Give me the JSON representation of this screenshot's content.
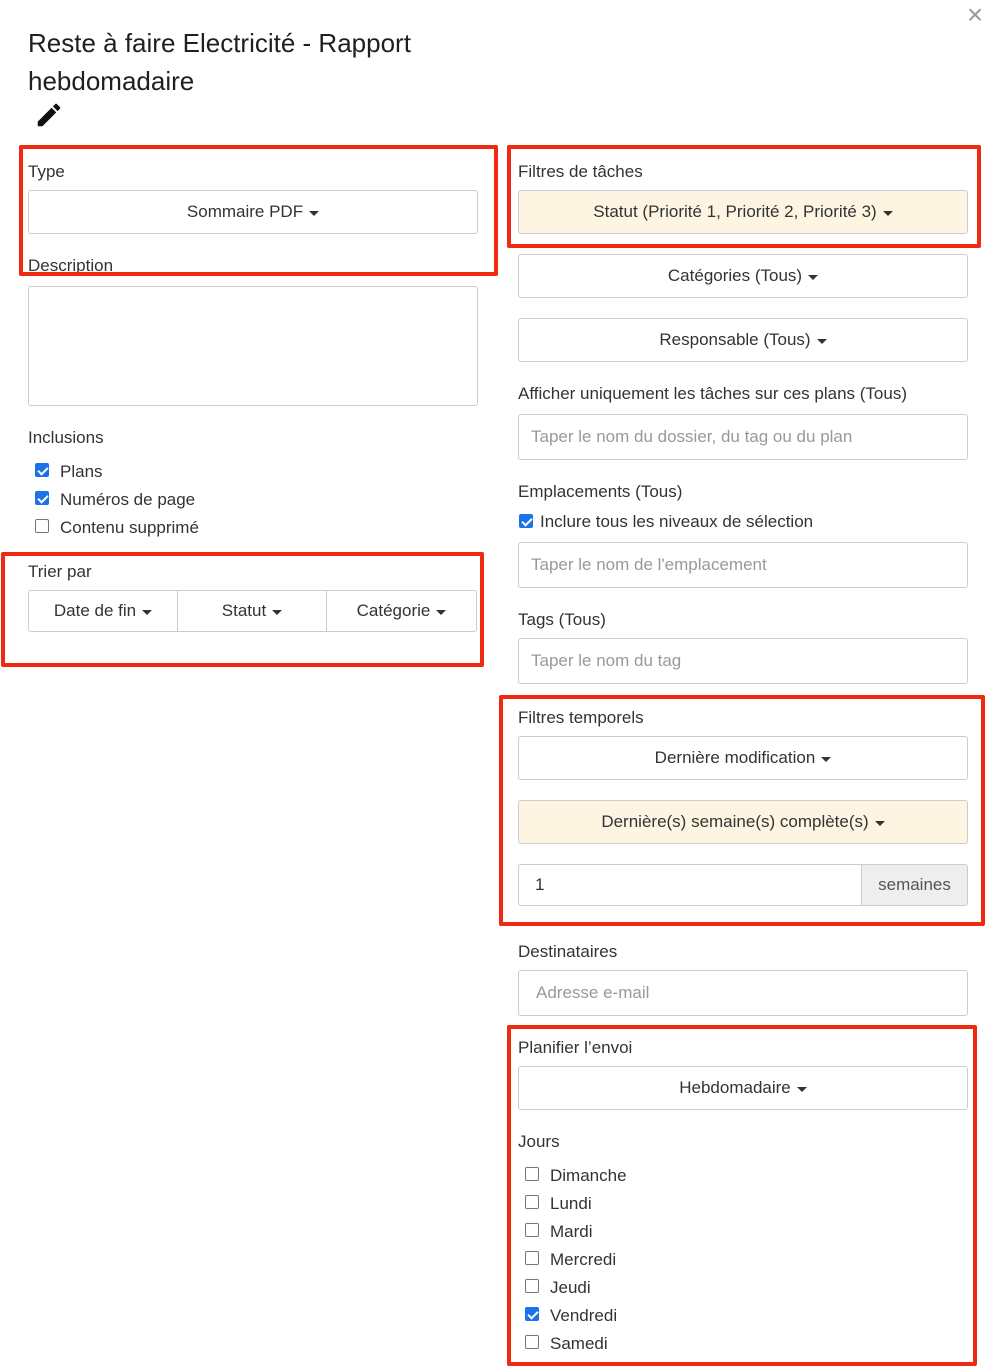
{
  "dialog": {
    "title": "Reste à faire Electricité - Rapport hebdomadaire",
    "close_symbol": "×",
    "edit_icon": "pencil-icon",
    "close_icon": "close-icon"
  },
  "left": {
    "type": {
      "label": "Type",
      "value": "Sommaire PDF"
    },
    "description": {
      "label": "Description",
      "value": ""
    },
    "inclusions": {
      "label": "Inclusions",
      "items": [
        {
          "label": "Plans",
          "checked": true
        },
        {
          "label": "Numéros de page",
          "checked": true
        },
        {
          "label": "Contenu supprimé",
          "checked": false
        }
      ]
    },
    "sort": {
      "label": "Trier par",
      "options": [
        "Date de fin",
        "Statut",
        "Catégorie"
      ]
    }
  },
  "right": {
    "task_filters": {
      "label": "Filtres de tâches",
      "status": "Statut (Priorité 1, Priorité 2, Priorité 3)",
      "categories": "Catégories (Tous)",
      "responsible": "Responsable (Tous)"
    },
    "plans": {
      "label": "Afficher uniquement les tâches sur ces plans (Tous)",
      "placeholder": "Taper le nom du dossier, du tag ou du plan"
    },
    "locations": {
      "label": "Emplacements (Tous)",
      "include_all_label": "Inclure tous les niveaux de sélection",
      "include_all_checked": true,
      "placeholder": "Taper le nom de l'emplacement"
    },
    "tags": {
      "label": "Tags (Tous)",
      "placeholder": "Taper le nom du tag"
    },
    "time_filters": {
      "label": "Filtres temporels",
      "field": "Dernière modification",
      "period": "Dernière(s) semaine(s) complète(s)",
      "count": "1",
      "unit": "semaines"
    },
    "recipients": {
      "label": "Destinataires",
      "placeholder": "Adresse e-mail"
    },
    "schedule": {
      "label": "Planifier l’envoi",
      "frequency": "Hebdomadaire",
      "days_label": "Jours",
      "days": [
        {
          "label": "Dimanche",
          "checked": false
        },
        {
          "label": "Lundi",
          "checked": false
        },
        {
          "label": "Mardi",
          "checked": false
        },
        {
          "label": "Mercredi",
          "checked": false
        },
        {
          "label": "Jeudi",
          "checked": false
        },
        {
          "label": "Vendredi",
          "checked": true
        },
        {
          "label": "Samedi",
          "checked": false
        }
      ]
    }
  },
  "colors": {
    "highlight_box": "#ee2a12",
    "selected_button_bg": "#fdf5e2",
    "checkbox_checked": "#1a73e8"
  }
}
